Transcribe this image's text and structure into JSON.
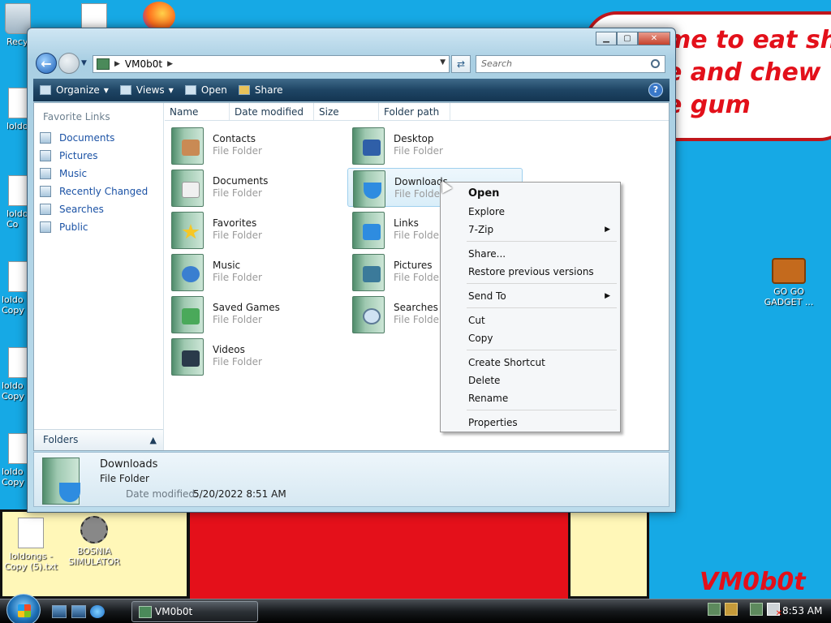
{
  "wallpaper": {
    "speech_text": "me to eat shit\ne and chew\ne gum",
    "watermark": "VM0b0t"
  },
  "desktop_icons": [
    {
      "label": "Recy"
    },
    {
      "label": "loldo"
    },
    {
      "label": "loldo\nCo"
    },
    {
      "label": "loldo\nCopy"
    },
    {
      "label": "loldo\nCopy"
    },
    {
      "label": "loldo\nCopy"
    },
    {
      "label": "loldongs -\nCopy (5).txt"
    },
    {
      "label": "BOSNIA\nSIMULATOR"
    },
    {
      "label": "GO GO\nGADGET ..."
    }
  ],
  "window": {
    "address": {
      "path": "VM0b0t"
    },
    "search_placeholder": "Search",
    "toolbar": {
      "organize": "Organize",
      "views": "Views",
      "open": "Open",
      "share": "Share",
      "help": "?"
    },
    "nav": {
      "title": "Favorite Links",
      "items": [
        "Documents",
        "Pictures",
        "Music",
        "Recently Changed",
        "Searches",
        "Public"
      ],
      "folders_label": "Folders"
    },
    "columns": [
      "Name",
      "Date modified",
      "Size",
      "Folder path"
    ],
    "items": [
      {
        "name": "Contacts",
        "type": "File Folder"
      },
      {
        "name": "Desktop",
        "type": "File Folder"
      },
      {
        "name": "Documents",
        "type": "File Folder"
      },
      {
        "name": "Downloads",
        "type": "File Folder"
      },
      {
        "name": "Favorites",
        "type": "File Folder"
      },
      {
        "name": "Links",
        "type": "File Folder"
      },
      {
        "name": "Music",
        "type": "File Folder"
      },
      {
        "name": "Pictures",
        "type": "File Folder"
      },
      {
        "name": "Saved Games",
        "type": "File Folder"
      },
      {
        "name": "Searches",
        "type": "File Folder"
      },
      {
        "name": "Videos",
        "type": "File Folder"
      }
    ],
    "details": {
      "name": "Downloads",
      "type": "File Folder",
      "modified_label": "Date modified:",
      "modified_value": "5/20/2022 8:51 AM"
    }
  },
  "context_menu": {
    "items": [
      "Open",
      "Explore",
      "7-Zip",
      "Share...",
      "Restore previous versions",
      "Send To",
      "Cut",
      "Copy",
      "Create Shortcut",
      "Delete",
      "Rename",
      "Properties"
    ]
  },
  "taskbar": {
    "task_label": "VM0b0t",
    "clock": "8:53 AM"
  }
}
